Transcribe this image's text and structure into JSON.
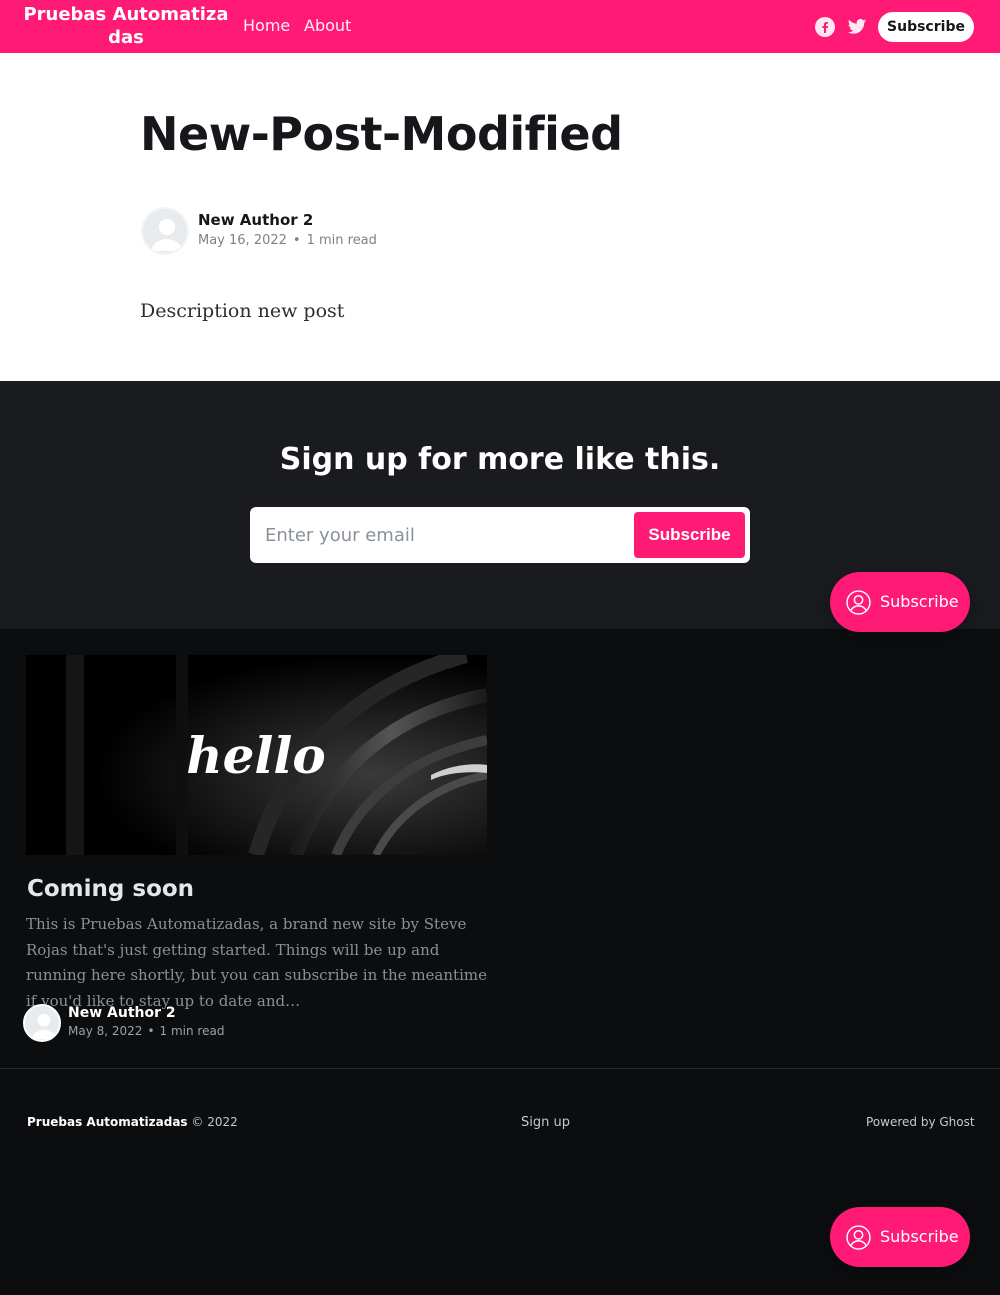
{
  "header": {
    "brand": "Pruebas Automatizadas",
    "nav": [
      {
        "label": "Home"
      },
      {
        "label": "About"
      }
    ],
    "subscribe_label": "Subscribe",
    "social": [
      "facebook-icon",
      "twitter-icon"
    ]
  },
  "post": {
    "title": "New-Post-Modified",
    "author": "New Author 2",
    "date": "May 16, 2022",
    "reading_time": "1 min read",
    "body": "Description new post"
  },
  "cta": {
    "title": "Sign up for more like this.",
    "email_placeholder": "Enter your email",
    "button_label": "Subscribe"
  },
  "portal": {
    "label": "Subscribe"
  },
  "related": [
    {
      "image_text": "hello",
      "title": "Coming soon",
      "excerpt": "This is Pruebas Automatizadas, a brand new site by Steve Rojas that's just getting started. Things will be up and running here shortly, but you can subscribe in the meantime if you'd like to stay up to date and…",
      "author": "New Author 2",
      "date": "May 8, 2022",
      "reading_time": "1 min read"
    }
  ],
  "footer": {
    "site_name": "Pruebas Automatizadas",
    "copyright": "© 2022",
    "signup_label": "Sign up",
    "powered_by": "Powered by Ghost"
  },
  "colors": {
    "accent": "#ff1a75",
    "cta_background": "#1a1b1f",
    "feed_background": "#0c0d0f"
  }
}
